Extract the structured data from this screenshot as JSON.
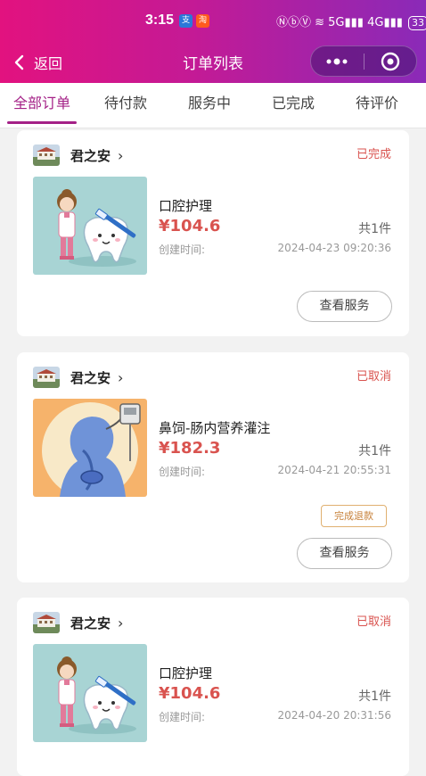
{
  "status_bar": {
    "time": "3:15",
    "right_icons_text": "ⓃⓑⓋ ≋ 5G▮▮▮ 4G▮▮▮",
    "battery": "33"
  },
  "header": {
    "back_label": "返回",
    "title": "订单列表"
  },
  "tabs": [
    {
      "label": "全部订单",
      "active": true
    },
    {
      "label": "待付款",
      "active": false
    },
    {
      "label": "服务中",
      "active": false
    },
    {
      "label": "已完成",
      "active": false
    },
    {
      "label": "待评价",
      "active": false
    }
  ],
  "orders": [
    {
      "shop": "君之安",
      "status": "已完成",
      "service": "口腔护理",
      "price": "¥104.6",
      "quantity": "共1件",
      "created_label": "创建时间:",
      "created_time": "2024-04-23 09:20:36",
      "view_button": "查看服务",
      "thumb": "dental-care-illustration"
    },
    {
      "shop": "君之安",
      "status": "已取消",
      "service": "鼻饲-肠内营养灌注",
      "price": "¥182.3",
      "quantity": "共1件",
      "created_label": "创建时间:",
      "created_time": "2024-04-21 20:55:31",
      "refund_button": "完成退款",
      "view_button": "查看服务",
      "thumb": "nasogastric-feeding-illustration"
    },
    {
      "shop": "君之安",
      "status": "已取消",
      "service": "口腔护理",
      "price": "¥104.6",
      "quantity": "共1件",
      "created_label": "创建时间:",
      "created_time": "2024-04-20 20:31:56",
      "thumb": "dental-care-illustration"
    }
  ],
  "colors": {
    "accent": "#a42187",
    "status_red": "#d9534f",
    "refund_orange": "#c7813a",
    "header_gradient_start": "#e2127f",
    "header_gradient_end": "#8a2ab8"
  }
}
